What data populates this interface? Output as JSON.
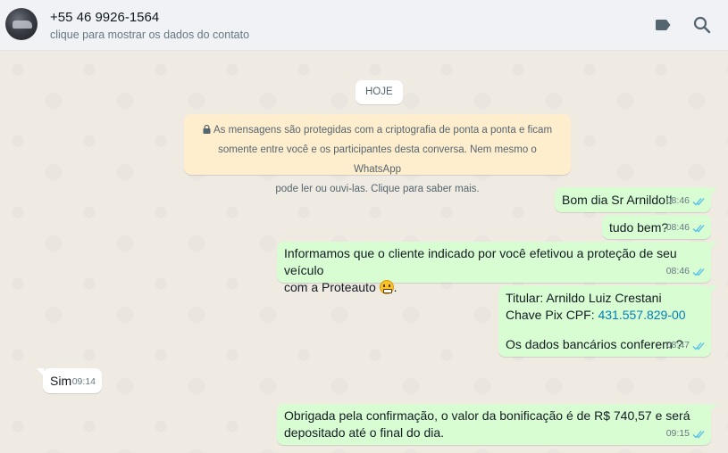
{
  "header": {
    "contact_name": "+55 46 9926-1564",
    "contact_subtitle": "clique para mostrar os dados do contato",
    "icons": [
      "label-icon",
      "search-icon"
    ]
  },
  "chat": {
    "day_label": "HOJE",
    "encryption_notice": [
      "As mensagens são protegidas com a criptografia de ponta a ponta e ficam",
      "somente entre você e os participantes desta conversa. Nem mesmo o WhatsApp",
      "pode ler ou ouvi-las. Clique para saber mais."
    ],
    "messages": [
      {
        "direction": "out",
        "text": "Bom dia Sr Arnildo!!",
        "time": "08:46",
        "status": "read"
      },
      {
        "direction": "out",
        "text": "tudo bem?",
        "time": "08:46",
        "status": "read"
      },
      {
        "direction": "out",
        "lines": [
          "Informamos que o cliente indicado por você efetivou a proteção de seu veículo",
          "com a Proteauto",
          "."
        ],
        "time": "08:46",
        "status": "read"
      },
      {
        "direction": "out",
        "lines": [
          "Titular: Arnildo Luiz Crestani",
          "Chave Pix CPF: ",
          "431.557.829-00",
          "Os dados bancários conferem ?"
        ],
        "time": "08:47",
        "status": "read"
      },
      {
        "direction": "in",
        "text": "Sim",
        "time": "09:14"
      },
      {
        "direction": "out",
        "lines": [
          "Obrigada pela confirmação, o valor da bonificação é de R$ 740,57 e será",
          "depositado até o final do dia."
        ],
        "time": "09:15",
        "status": "read"
      }
    ]
  },
  "colors": {
    "outgoing_bubble": "#d9fdd3",
    "incoming_bubble": "#ffffff",
    "notice_bg": "#ffeecd",
    "read_ticks": "#53bdeb",
    "link": "#027eb5"
  }
}
